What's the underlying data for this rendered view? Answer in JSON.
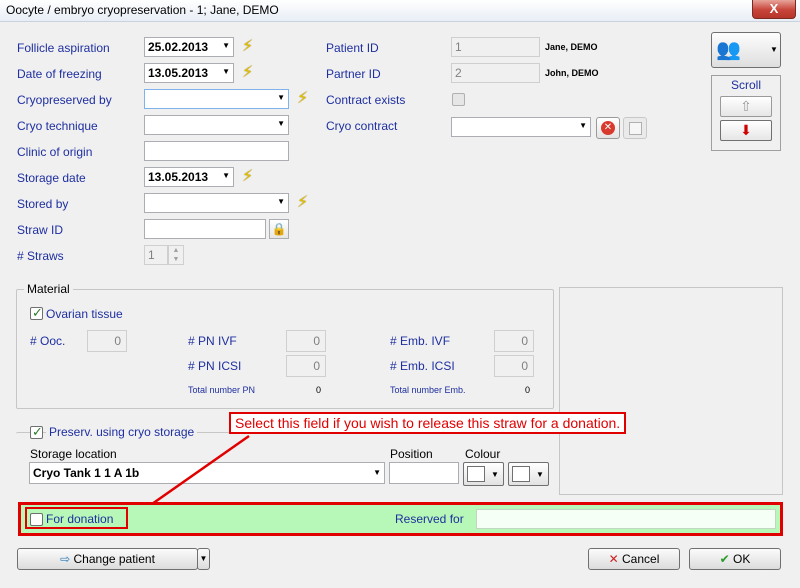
{
  "window": {
    "title": "Oocyte / embryo cryopreservation - 1; Jane, DEMO",
    "close": "X"
  },
  "left": {
    "follicle_aspiration": {
      "label": "Follicle aspiration",
      "value": "25.02.2013"
    },
    "date_of_freezing": {
      "label": "Date of freezing",
      "value": "13.05.2013"
    },
    "cryopreserved_by": {
      "label": "Cryopreserved by",
      "value": ""
    },
    "cryo_technique": {
      "label": "Cryo technique",
      "value": ""
    },
    "clinic_of_origin": {
      "label": "Clinic of origin",
      "value": ""
    },
    "storage_date": {
      "label": "Storage date",
      "value": "13.05.2013"
    },
    "stored_by": {
      "label": "Stored by",
      "value": ""
    },
    "straw_id": {
      "label": "Straw ID",
      "value": ""
    },
    "straws": {
      "label": "# Straws",
      "value": "1"
    }
  },
  "right": {
    "patient_id": {
      "label": "Patient ID",
      "value": "1",
      "name": "Jane, DEMO"
    },
    "partner_id": {
      "label": "Partner ID",
      "value": "2",
      "name": "John, DEMO"
    },
    "contract_exists": {
      "label": "Contract exists"
    },
    "cryo_contract": {
      "label": "Cryo contract",
      "value": ""
    }
  },
  "scroll": {
    "label": "Scroll"
  },
  "material": {
    "title": "Material",
    "ovarian_tissue": "Ovarian tissue",
    "ooc": {
      "label": "# Ooc.",
      "value": "0"
    },
    "pn_ivf": {
      "label": "# PN IVF",
      "value": "0"
    },
    "pn_icsi": {
      "label": "# PN ICSI",
      "value": "0"
    },
    "total_pn": {
      "label": "Total number PN",
      "value": "0"
    },
    "emb_ivf": {
      "label": "# Emb. IVF",
      "value": "0"
    },
    "emb_icsi": {
      "label": "# Emb. ICSI",
      "value": "0"
    },
    "total_emb": {
      "label": "Total number Emb.",
      "value": "0"
    }
  },
  "preserv": {
    "title": "Preserv. using cryo storage",
    "storage_location_label": "Storage location",
    "storage_location_value": "Cryo Tank 1 1 A 1b",
    "position_label": "Position",
    "position_value": "",
    "colour_label": "Colour"
  },
  "donation": {
    "label": "For donation",
    "reserved_for_label": "Reserved for",
    "reserved_for_value": ""
  },
  "callout": "Select this field if you wish to release this straw for a donation.",
  "buttons": {
    "change_patient": "Change patient",
    "cancel": "Cancel",
    "ok": "OK"
  },
  "colors": {
    "accent_label": "#1e2fa0",
    "callout_red": "#e00000",
    "donation_bg": "#b7f7b7"
  }
}
